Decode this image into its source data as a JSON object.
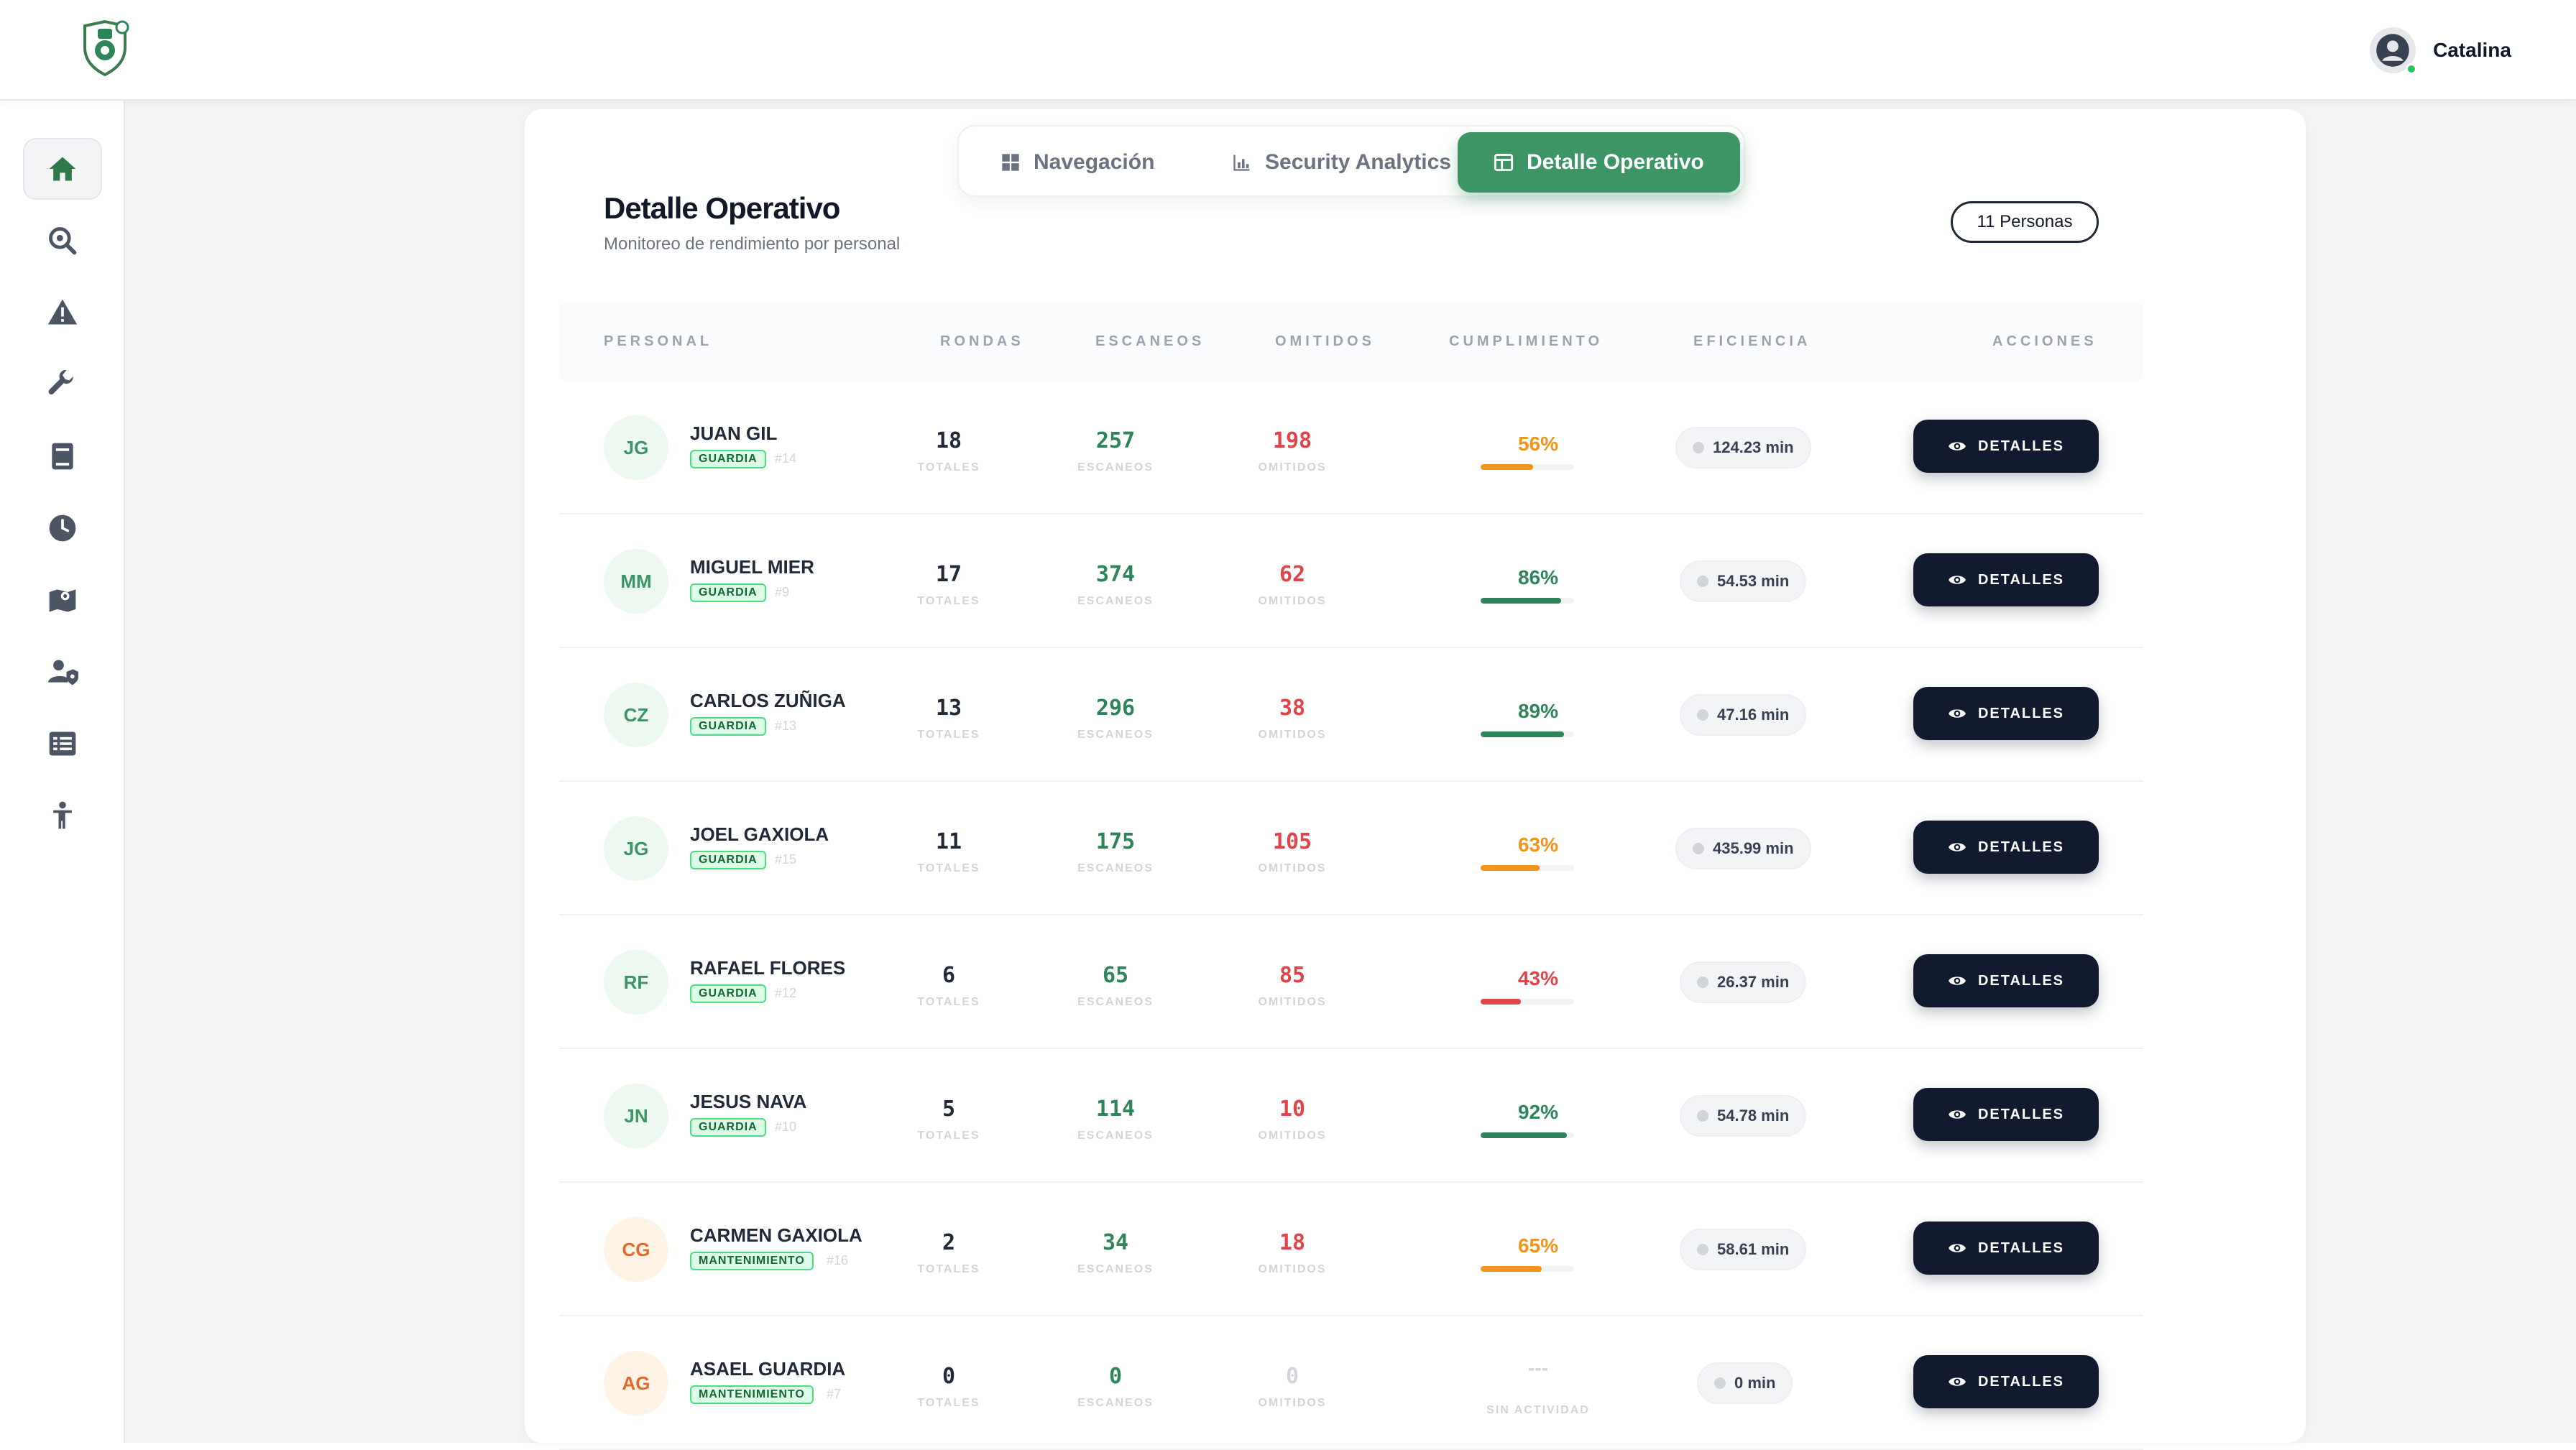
{
  "header": {
    "user_name": "Catalina"
  },
  "sidebar": {
    "items": [
      {
        "icon": "home-icon",
        "active": true
      },
      {
        "icon": "search-icon"
      },
      {
        "icon": "alert-icon"
      },
      {
        "icon": "wrench-icon"
      },
      {
        "icon": "book-icon"
      },
      {
        "icon": "clock-icon"
      },
      {
        "icon": "map-icon"
      },
      {
        "icon": "user-shield-icon"
      },
      {
        "icon": "list-icon"
      },
      {
        "icon": "person-icon"
      }
    ]
  },
  "tabs": [
    {
      "label": "Navegación",
      "icon": "grid-icon"
    },
    {
      "label": "Security Analytics",
      "icon": "bar-chart-icon"
    },
    {
      "label": "Detalle Operativo",
      "icon": "table-icon",
      "active": true
    }
  ],
  "page": {
    "title": "Detalle Operativo",
    "subtitle": "Monitoreo de rendimiento por personal",
    "count_badge": "11 Personas"
  },
  "table": {
    "columns": [
      "PERSONAL",
      "RONDAS",
      "ESCANEOS",
      "OMITIDOS",
      "CUMPLIMIENTO",
      "EFICIENCIA",
      "ACCIONES"
    ],
    "labels": {
      "rondas": "TOTALES",
      "escaneos": "ESCANEOS",
      "omitidos": "OMITIDOS",
      "sin_actividad": "SIN ACTIVIDAD"
    },
    "action_label": "DETALLES",
    "rows": [
      {
        "initials": "JG",
        "name": "JUAN GIL",
        "role": "GUARDIA",
        "id": "#14",
        "rondas": "18",
        "escaneos": "257",
        "omitidos": "198",
        "cumplimiento": "56%",
        "cumplimiento_value": 0.56,
        "status": "orange",
        "eficiencia": "124.23 min"
      },
      {
        "initials": "MM",
        "name": "MIGUEL MIER",
        "role": "GUARDIA",
        "id": "#9",
        "rondas": "17",
        "escaneos": "374",
        "omitidos": "62",
        "cumplimiento": "86%",
        "cumplimiento_value": 0.86,
        "status": "green",
        "eficiencia": "54.53 min"
      },
      {
        "initials": "CZ",
        "name": "CARLOS ZUÑIGA",
        "role": "GUARDIA",
        "id": "#13",
        "rondas": "13",
        "escaneos": "296",
        "omitidos": "38",
        "cumplimiento": "89%",
        "cumplimiento_value": 0.89,
        "status": "green",
        "eficiencia": "47.16 min"
      },
      {
        "initials": "JG",
        "name": "JOEL GAXIOLA",
        "role": "GUARDIA",
        "id": "#15",
        "rondas": "11",
        "escaneos": "175",
        "omitidos": "105",
        "cumplimiento": "63%",
        "cumplimiento_value": 0.63,
        "status": "orange",
        "eficiencia": "435.99 min"
      },
      {
        "initials": "RF",
        "name": "RAFAEL FLORES",
        "role": "GUARDIA",
        "id": "#12",
        "rondas": "6",
        "escaneos": "65",
        "omitidos": "85",
        "cumplimiento": "43%",
        "cumplimiento_value": 0.43,
        "status": "red",
        "eficiencia": "26.37 min"
      },
      {
        "initials": "JN",
        "name": "JESUS NAVA",
        "role": "GUARDIA",
        "id": "#10",
        "rondas": "5",
        "escaneos": "114",
        "omitidos": "10",
        "cumplimiento": "92%",
        "cumplimiento_value": 0.92,
        "status": "green",
        "eficiencia": "54.78 min"
      },
      {
        "initials": "CG",
        "name": "CARMEN GAXIOLA",
        "role": "MANTENIMIENTO",
        "id": "#16",
        "rondas": "2",
        "escaneos": "34",
        "omitidos": "18",
        "cumplimiento": "65%",
        "cumplimiento_value": 0.65,
        "status": "orange",
        "eficiencia": "58.61 min"
      },
      {
        "initials": "AG",
        "name": "ASAEL GUARDIA",
        "role": "MANTENIMIENTO",
        "id": "#7",
        "rondas": "0",
        "escaneos": "0",
        "omitidos": "0",
        "cumplimiento": "---",
        "cumplimiento_value": 0,
        "status": "none",
        "eficiencia": "0 min"
      }
    ]
  },
  "colors": {
    "accent": "#3d9566",
    "dark_button": "#111a2e",
    "green": "#2f855a",
    "red": "#e0454a",
    "orange": "#f0941b"
  }
}
